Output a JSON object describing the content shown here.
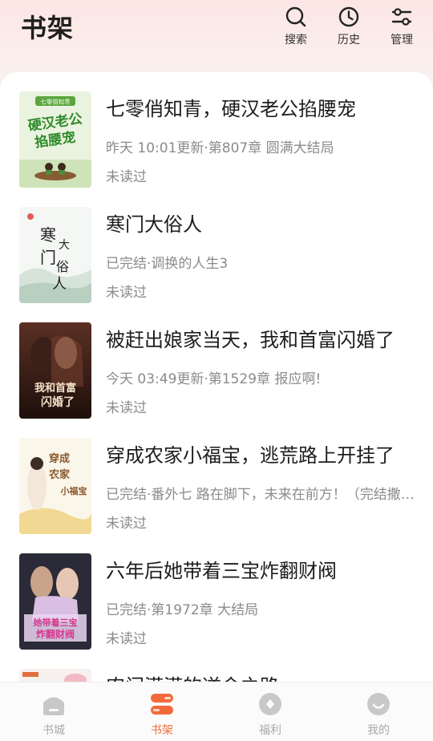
{
  "header": {
    "title": "书架",
    "actions": [
      {
        "label": "搜索",
        "icon": "search-icon"
      },
      {
        "label": "历史",
        "icon": "clock-icon"
      },
      {
        "label": "管理",
        "icon": "sliders-icon"
      }
    ]
  },
  "books": [
    {
      "title": "七零俏知青，硬汉老公掐腰宠",
      "info": "昨天 10:01更新·第807章 圆满大结局",
      "status": "未读过"
    },
    {
      "title": "寒门大俗人",
      "info": "已完结·调换的人生3",
      "status": "未读过"
    },
    {
      "title": "被赶出娘家当天，我和首富闪婚了",
      "info": "今天 03:49更新·第1529章 报应啊!",
      "status": "未读过"
    },
    {
      "title": "穿成农家小福宝，逃荒路上开挂了",
      "info": "已完结·番外七 路在脚下，未来在前方！（完结撒花）",
      "status": "未读过"
    },
    {
      "title": "六年后她带着三宝炸翻财阀",
      "info": "已完结·第1972章 大结局",
      "status": "未读过"
    },
    {
      "title": "农门滢滢的逆命之路",
      "info": "",
      "status": ""
    }
  ],
  "covers": [
    {
      "text_lines": [
        "七零俏知青",
        "硬汉老公",
        "掐腰宠"
      ]
    },
    {
      "text_lines": [
        "寒",
        "大",
        "门",
        "俗",
        "人"
      ]
    },
    {
      "text_lines": [
        "我和首富",
        "闪婚了"
      ]
    },
    {
      "text_lines": [
        "穿成",
        "农家",
        "小福宝"
      ]
    },
    {
      "text_lines": [
        "她带着三宝",
        "炸翻财阀"
      ]
    },
    {
      "text_lines": []
    }
  ],
  "tabbar": {
    "tabs": [
      {
        "label": "书城",
        "icon": "bookstore-icon"
      },
      {
        "label": "书架",
        "icon": "bookshelf-icon",
        "active": true
      },
      {
        "label": "福利",
        "icon": "gift-icon"
      },
      {
        "label": "我的",
        "icon": "profile-icon"
      }
    ]
  },
  "colors": {
    "accent": "#f36a3a",
    "inactive": "#c8c8c8",
    "header_bg": "#fbe6e4"
  }
}
